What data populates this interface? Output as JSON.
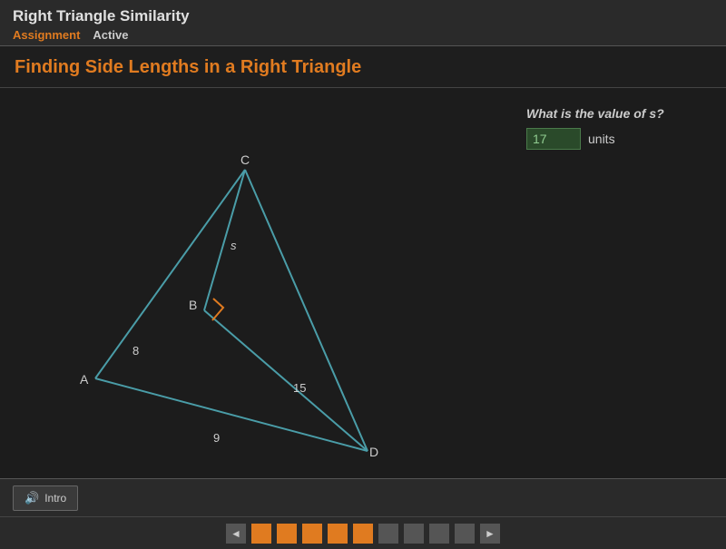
{
  "header": {
    "title": "Right Triangle Similarity",
    "assignment_label": "Assignment",
    "active_label": "Active"
  },
  "section": {
    "title": "Finding Side Lengths in a Right Triangle"
  },
  "question": {
    "text": "What is the value of ",
    "variable": "s",
    "text_end": "?",
    "answer_value": "17",
    "units": "units"
  },
  "diagram": {
    "labels": {
      "A": "A",
      "B": "B",
      "C": "C",
      "D": "D",
      "s": "s",
      "8": "8",
      "15": "15",
      "9": "9"
    }
  },
  "bottom": {
    "intro_label": "Intro"
  },
  "nav": {
    "prev": "◄",
    "next": "►",
    "dots": [
      {
        "id": 1,
        "state": "active"
      },
      {
        "id": 2,
        "state": "active"
      },
      {
        "id": 3,
        "state": "active"
      },
      {
        "id": 4,
        "state": "active"
      },
      {
        "id": 5,
        "state": "current"
      },
      {
        "id": 6,
        "state": "inactive"
      },
      {
        "id": 7,
        "state": "inactive"
      },
      {
        "id": 8,
        "state": "inactive"
      },
      {
        "id": 9,
        "state": "inactive"
      }
    ]
  }
}
